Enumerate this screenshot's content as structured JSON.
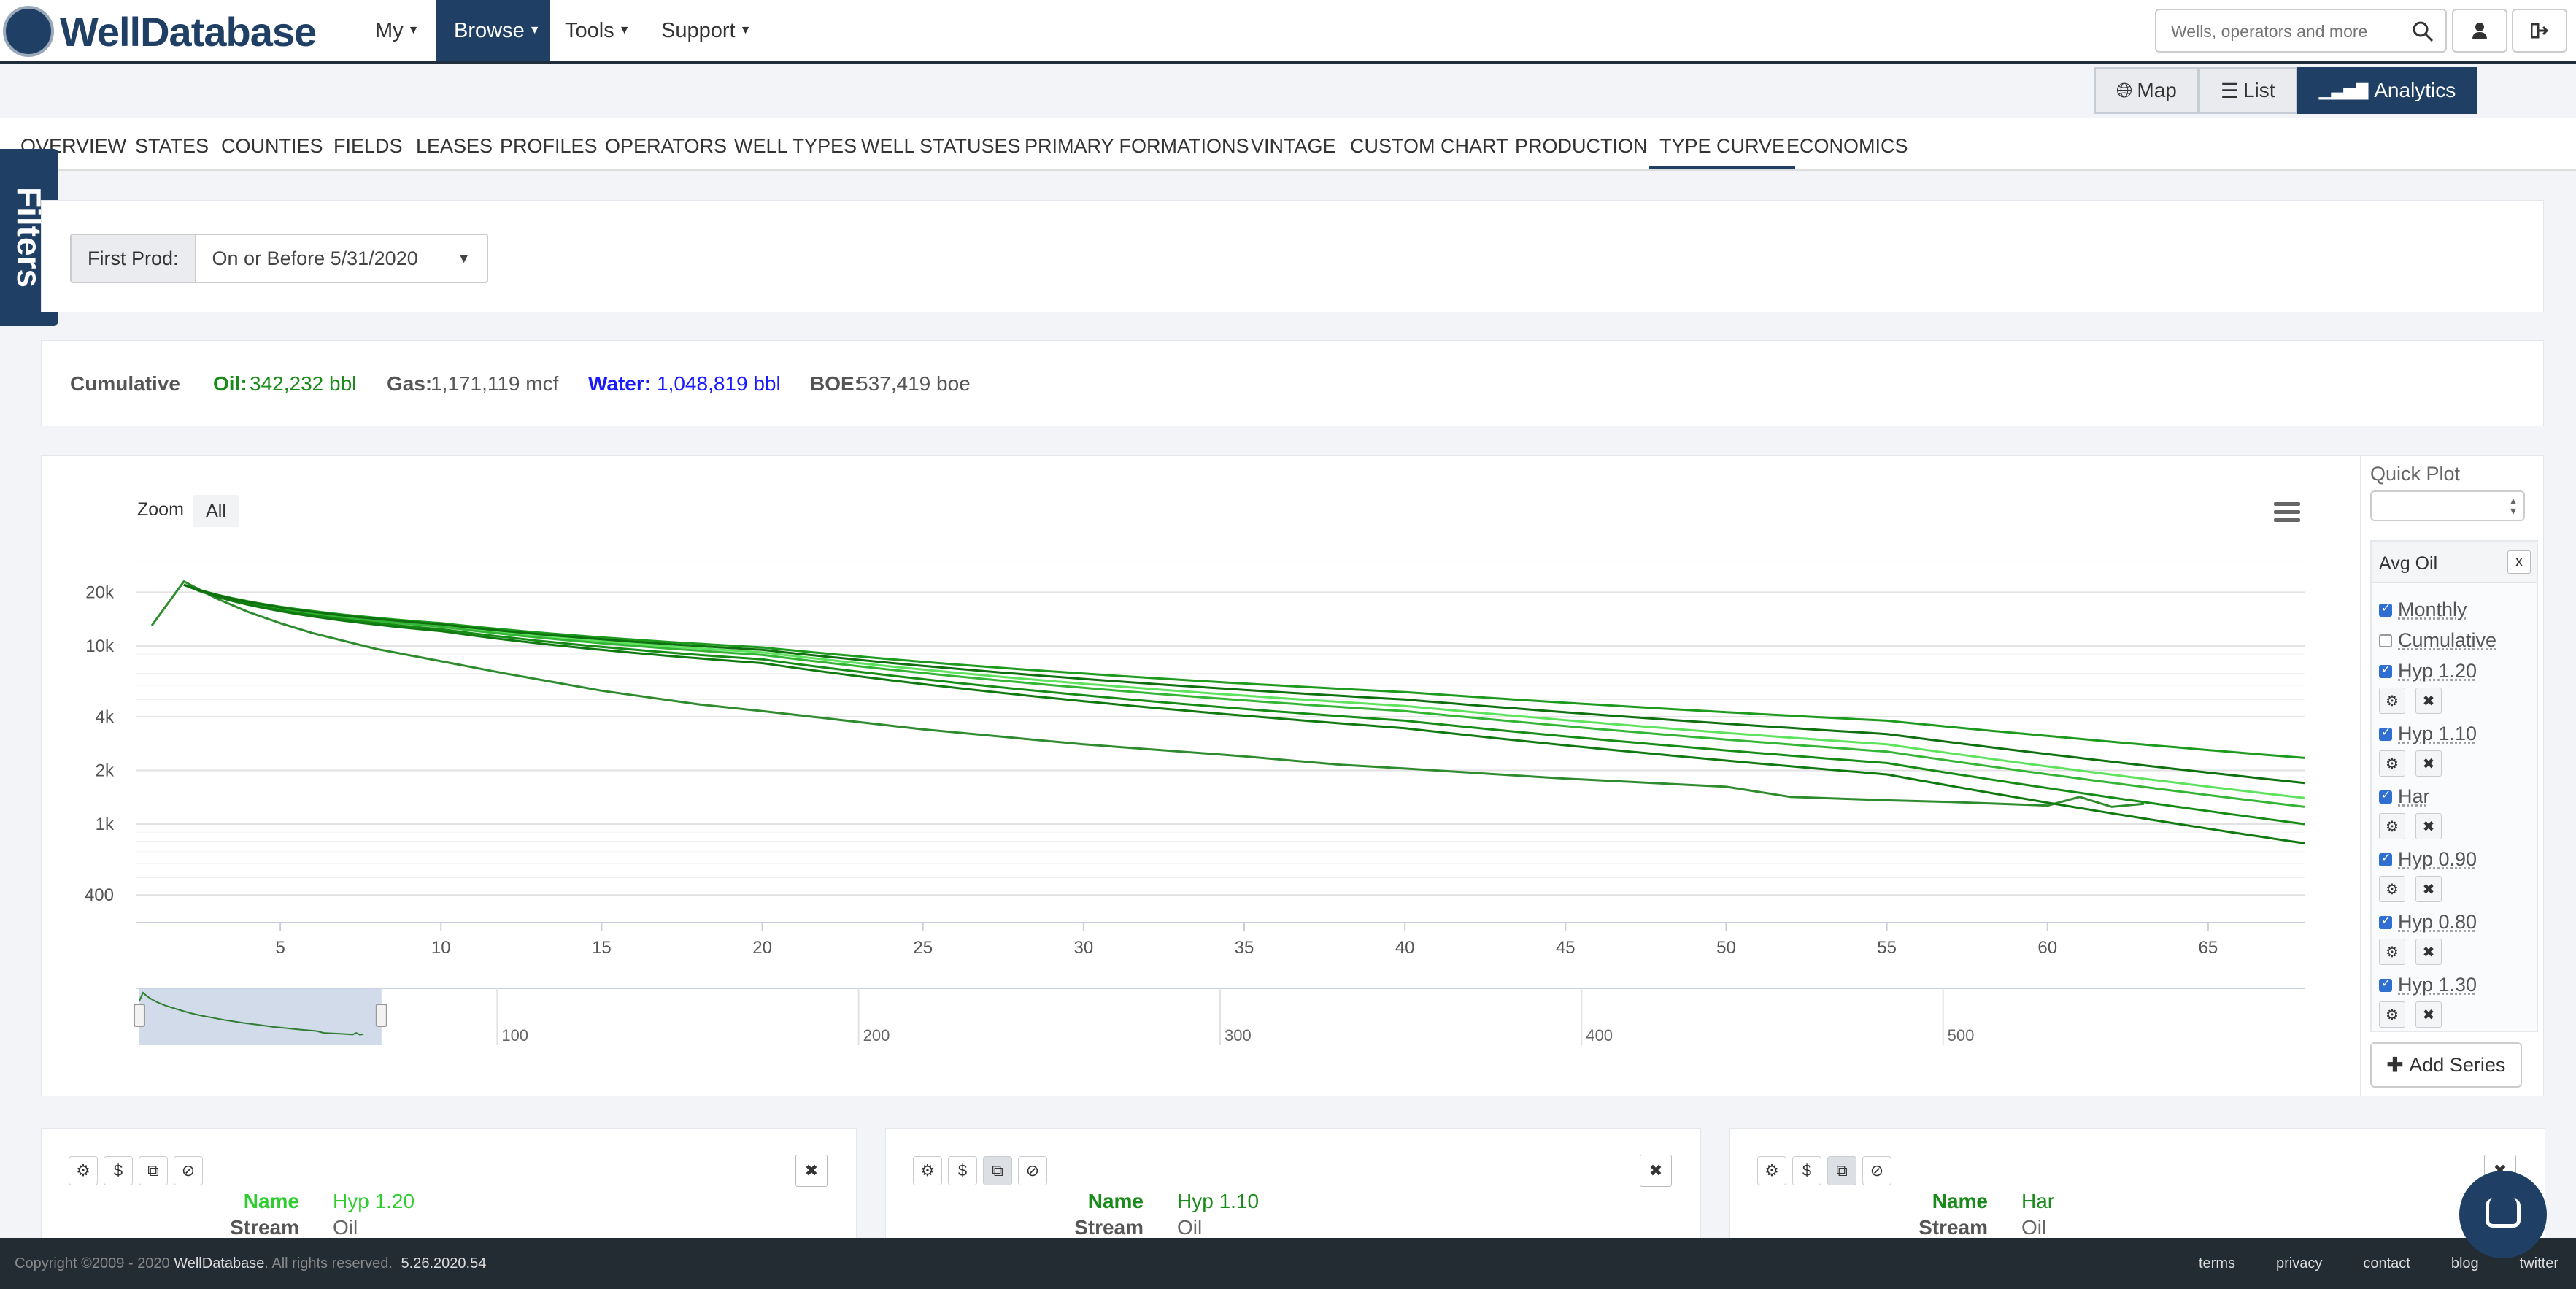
{
  "brand": {
    "name": "WellDatabase"
  },
  "nav": {
    "items": [
      {
        "label": "My",
        "active": false
      },
      {
        "label": "Browse",
        "active": true
      },
      {
        "label": "Tools",
        "active": false
      },
      {
        "label": "Support",
        "active": false
      }
    ]
  },
  "search": {
    "placeholder": "Wells, operators and more",
    "icon": "search-icon"
  },
  "header_icons": [
    "user-icon",
    "sign-out-icon"
  ],
  "views": [
    {
      "label": "Map",
      "icon": "globe-icon",
      "active": false
    },
    {
      "label": "List",
      "icon": "list-icon",
      "active": false
    },
    {
      "label": "Analytics",
      "icon": "bar-chart-icon",
      "active": true
    }
  ],
  "tabs": [
    "OVERVIEW",
    "STATES",
    "COUNTIES",
    "FIELDS",
    "LEASES",
    "PROFILES",
    "OPERATORS",
    "WELL TYPES",
    "WELL STATUSES",
    "PRIMARY FORMATIONS",
    "VINTAGE",
    "CUSTOM CHART",
    "PRODUCTION",
    "TYPE CURVE",
    "ECONOMICS"
  ],
  "active_tab": "TYPE CURVE",
  "filters_label": "Filters",
  "filter": {
    "label": "First Prod:",
    "value": "On or Before 5/31/2020"
  },
  "cumulative": {
    "label": "Cumulative",
    "oil_label": "Oil:",
    "oil_value": "342,232 bbl",
    "gas_label": "Gas:",
    "gas_value": "1,171,119 mcf",
    "water_label": "Water:",
    "water_value": "1,048,819 bbl",
    "boe_label": "BOE:",
    "boe_value": "537,419 boe",
    "colors": {
      "oil": "#1a8a1a",
      "water": "#1a1aff"
    }
  },
  "chart_controls": {
    "zoom_label": "Zoom",
    "zoom_all": "All"
  },
  "chart_data": {
    "type": "line",
    "title": "",
    "xlabel": "",
    "ylabel": "",
    "y_scale": "log",
    "xlim": [
      0.5,
      68
    ],
    "ylim": [
      280,
      35000
    ],
    "x_ticks": [
      5,
      10,
      15,
      20,
      25,
      30,
      35,
      40,
      45,
      50,
      55,
      60,
      65
    ],
    "y_ticks": [
      {
        "value": 400,
        "label": "400"
      },
      {
        "value": 1000,
        "label": "1k"
      },
      {
        "value": 2000,
        "label": "2k"
      },
      {
        "value": 4000,
        "label": "4k"
      },
      {
        "value": 10000,
        "label": "10k"
      },
      {
        "value": 20000,
        "label": "20k"
      }
    ],
    "grid": true,
    "legend": "none",
    "series": [
      {
        "name": "Monthly",
        "color": "#2e8b2e",
        "x": [
          1,
          2,
          3,
          4,
          5,
          6,
          8,
          10,
          12,
          15,
          18,
          20,
          25,
          30,
          35,
          38,
          40,
          45,
          50,
          52,
          55,
          57,
          60,
          61,
          62,
          63
        ],
        "y": [
          13000,
          23000,
          18500,
          15500,
          13400,
          11800,
          9600,
          8200,
          7000,
          5600,
          4700,
          4300,
          3400,
          2800,
          2400,
          2150,
          2050,
          1800,
          1620,
          1420,
          1360,
          1330,
          1270,
          1420,
          1250,
          1300
        ]
      },
      {
        "name": "Hyp 1.20",
        "color": "#5fe35f",
        "decline_fit": true,
        "ys": [
          22000,
          13000,
          9200,
          4600,
          2800,
          1400
        ]
      },
      {
        "name": "Hyp 1.10",
        "color": "#35b535",
        "decline_fit": true,
        "ys": [
          22000,
          12800,
          8900,
          4300,
          2550,
          1250
        ]
      },
      {
        "name": "Har",
        "color": "#1e9a1e",
        "decline_fit": true,
        "ys": [
          22000,
          13400,
          9800,
          5500,
          3800,
          2350
        ]
      },
      {
        "name": "Hyp 0.90",
        "color": "#168c16",
        "decline_fit": true,
        "ys": [
          22000,
          12400,
          8400,
          3800,
          2200,
          1000
        ]
      },
      {
        "name": "Hyp 0.80",
        "color": "#107a10",
        "decline_fit": true,
        "ys": [
          22000,
          12100,
          8000,
          3450,
          1900,
          780
        ]
      },
      {
        "name": "Hyp 1.30",
        "color": "#0e700e",
        "decline_fit": true,
        "ys": [
          22000,
          13200,
          9500,
          5000,
          3200,
          1700
        ]
      }
    ],
    "navigator": {
      "x_ticks": [
        100,
        200,
        300,
        400,
        500
      ],
      "range": [
        1,
        68
      ]
    }
  },
  "quick_plot": {
    "title": "Quick Plot",
    "box_title": "Avg Oil",
    "close": "x",
    "options": [
      {
        "label": "Monthly",
        "checked": true,
        "has_controls": false
      },
      {
        "label": "Cumulative",
        "checked": false,
        "has_controls": false
      },
      {
        "label": "Hyp 1.20",
        "checked": true,
        "has_controls": true
      },
      {
        "label": "Hyp 1.10",
        "checked": true,
        "has_controls": true
      },
      {
        "label": "Har",
        "checked": true,
        "has_controls": true
      },
      {
        "label": "Hyp 0.90",
        "checked": true,
        "has_controls": true
      },
      {
        "label": "Hyp 0.80",
        "checked": true,
        "has_controls": true
      },
      {
        "label": "Hyp 1.30",
        "checked": true,
        "has_controls": true
      }
    ],
    "add_series": "Add Series"
  },
  "cards": [
    {
      "name_label": "Name",
      "name_value": "Hyp 1.20",
      "name_color": "#2ecc2e",
      "stream_label": "Stream",
      "stream_value": "Oil",
      "pressed": [
        false,
        false,
        false,
        false
      ]
    },
    {
      "name_label": "Name",
      "name_value": "Hyp 1.10",
      "name_color": "#1a8a1a",
      "stream_label": "Stream",
      "stream_value": "Oil",
      "pressed": [
        false,
        false,
        true,
        false
      ]
    },
    {
      "name_label": "Name",
      "name_value": "Har",
      "name_color": "#1a8a1a",
      "stream_label": "Stream",
      "stream_value": "Oil",
      "pressed": [
        false,
        false,
        true,
        false
      ]
    }
  ],
  "footer": {
    "copyright": "Copyright ©2009 - 2020",
    "brand": "WellDatabase",
    "rights": ". All rights reserved.",
    "version": "5.26.2020.54",
    "links": [
      "terms",
      "privacy",
      "contact",
      "blog",
      "twitter"
    ]
  }
}
